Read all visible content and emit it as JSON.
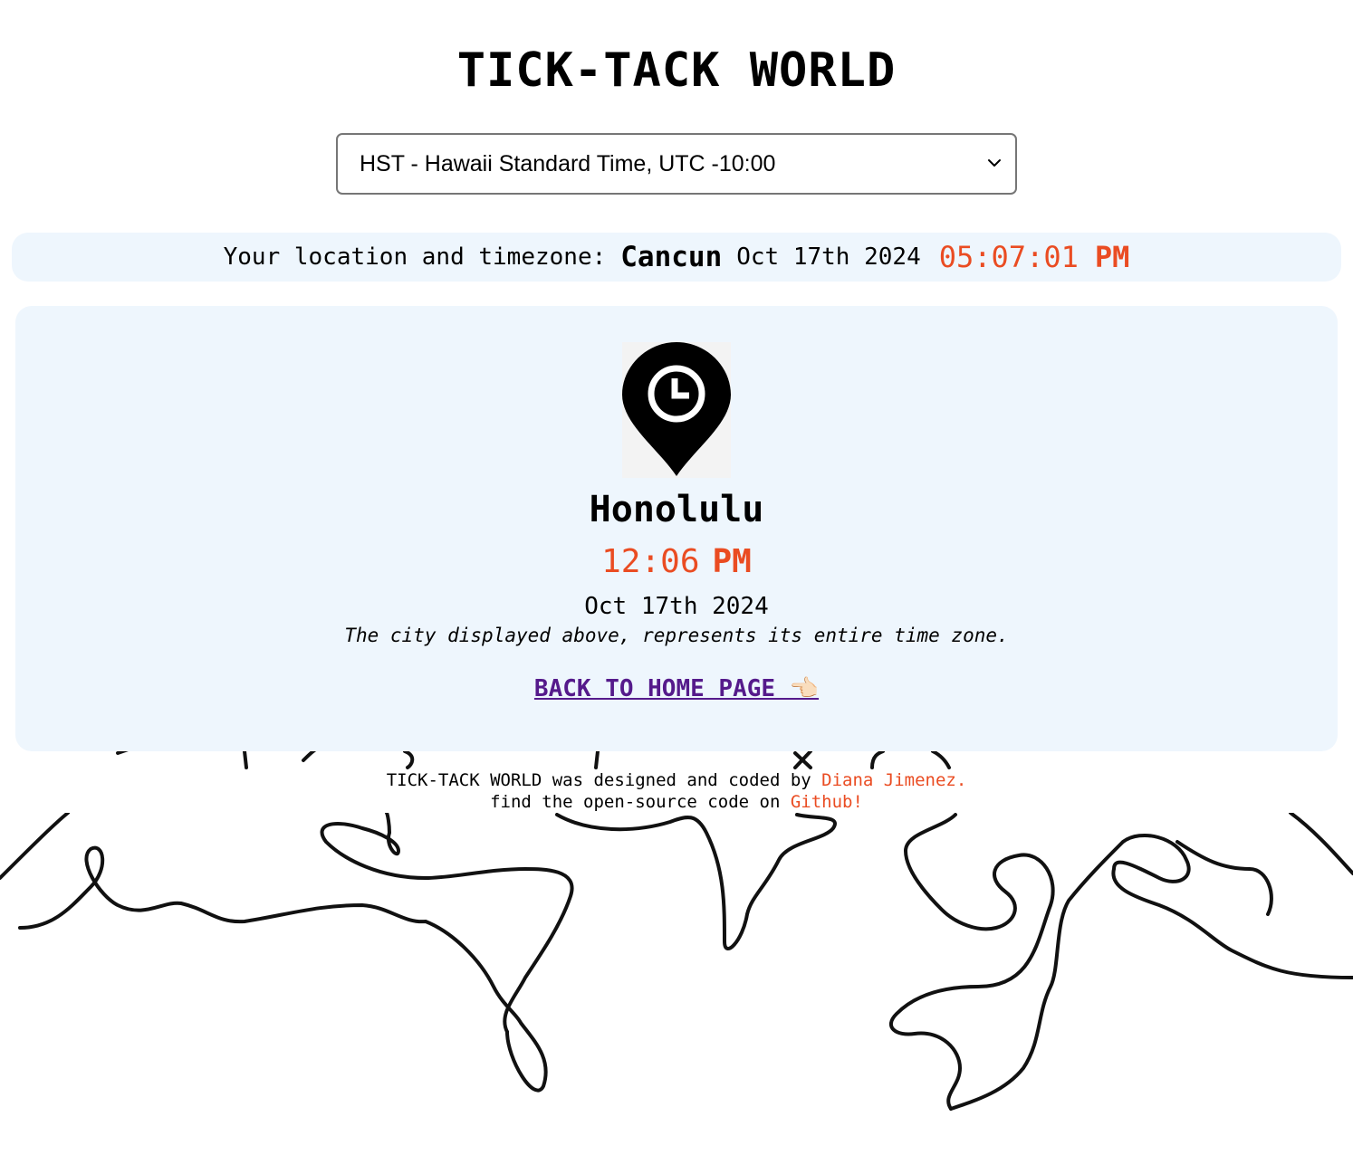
{
  "header": {
    "title": "TICK-TACK WORLD"
  },
  "timezone_select": {
    "selected": "HST - Hawaii Standard Time, UTC -10:00"
  },
  "local": {
    "label": "Your location and timezone:",
    "city": "Cancun",
    "date": "Oct 17th 2024",
    "time": "05:07:01",
    "ampm": "PM"
  },
  "selected_city": {
    "icon": "location-clock-pin-icon",
    "name": "Honolulu",
    "time": "12:06",
    "ampm": "PM",
    "date": "Oct 17th 2024",
    "note": "The city displayed above, represents its entire time zone.",
    "back_link": "BACK TO HOME PAGE 👈🏻"
  },
  "footer": {
    "line1_prefix": "TICK-TACK WORLD was designed and coded by ",
    "author_link": "Diana Jimenez.",
    "line2_prefix": "find the open-source code on ",
    "github_link": "Github!"
  },
  "colors": {
    "accent": "#ea4c22",
    "panel_bg": "#eef6fd",
    "link_visited": "#551a8b"
  }
}
